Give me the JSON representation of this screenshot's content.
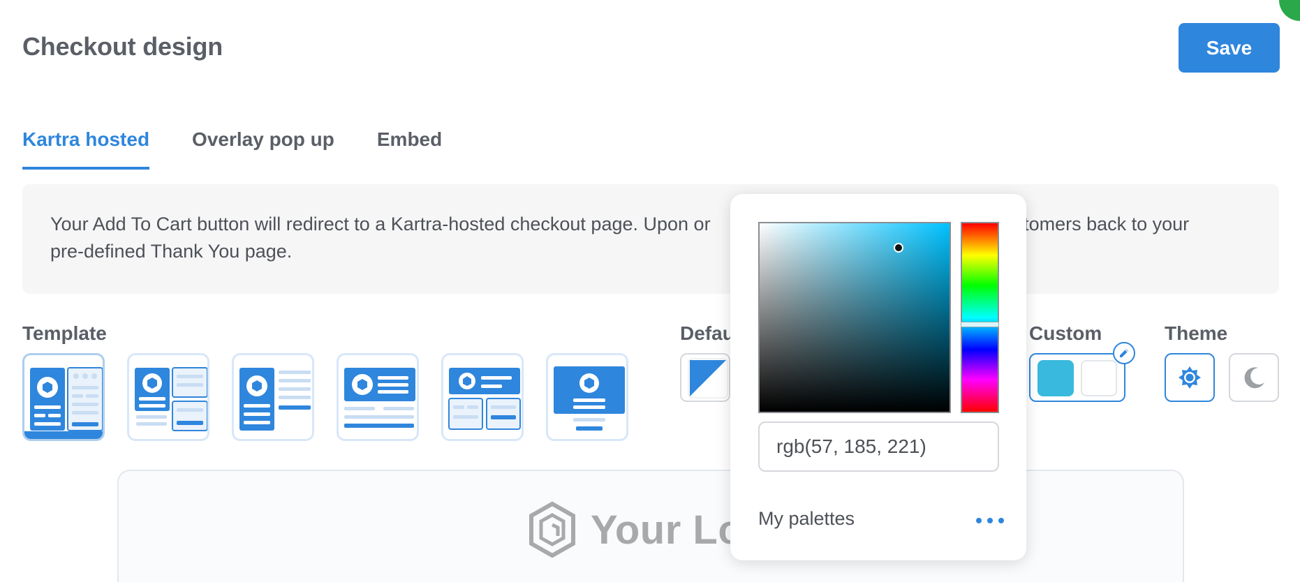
{
  "header": {
    "title": "Checkout design",
    "save_label": "Save"
  },
  "tabs": [
    {
      "label": "Kartra hosted",
      "active": true
    },
    {
      "label": "Overlay pop up",
      "active": false
    },
    {
      "label": "Embed",
      "active": false
    }
  ],
  "info": {
    "text": "Your Add To Cart button will redirect to a Kartra-hosted checkout page. Upon or",
    "text_tail": "ustomers back to your",
    "text_line2": "pre-defined Thank You page."
  },
  "sections": {
    "template_label": "Template",
    "default_label": "Defau",
    "custom_label": "Custom",
    "theme_label": "Theme"
  },
  "templates": [
    {
      "name": "template-1",
      "selected": true
    },
    {
      "name": "template-2",
      "selected": false
    },
    {
      "name": "template-3",
      "selected": false
    },
    {
      "name": "template-4",
      "selected": false
    },
    {
      "name": "template-5",
      "selected": false
    },
    {
      "name": "template-6",
      "selected": false
    }
  ],
  "custom_colors": {
    "primary": "#39b9dd",
    "secondary": "#ffffff"
  },
  "theme": {
    "options": [
      "light",
      "dark"
    ],
    "selected": "light",
    "light_icon": "sun-icon",
    "dark_icon": "moon-icon"
  },
  "color_picker": {
    "value": "rgb(57, 185, 221)",
    "hue_color": "#00c2ff",
    "saturation": 0.73,
    "brightness": 0.87,
    "hue_degrees": 193,
    "palettes_label": "My palettes",
    "more_icon": "more-horizontal-icon"
  },
  "preview": {
    "logo_text": "Your Lo",
    "logo_icon": "logo-hexagon-icon"
  },
  "colors": {
    "accent": "#2f86dd",
    "tab_border_light": "#d8e7f8",
    "text": "#5a5e66"
  }
}
